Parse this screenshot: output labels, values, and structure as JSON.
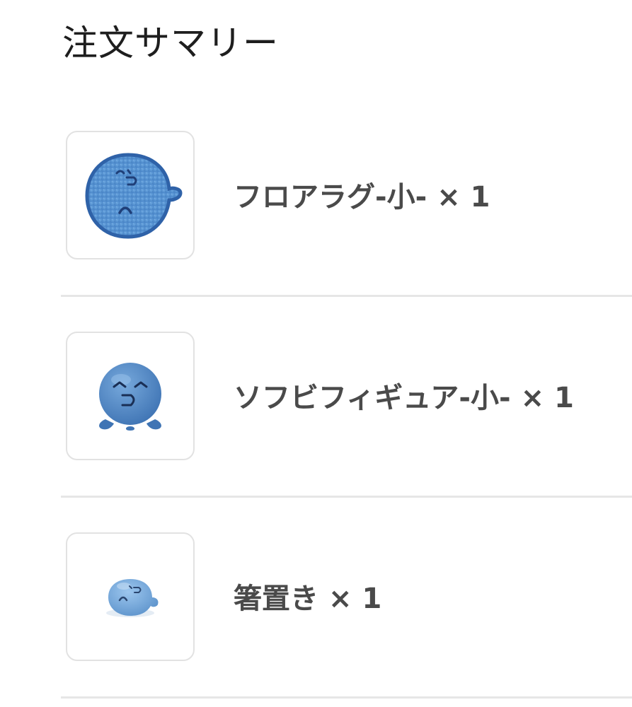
{
  "summary": {
    "title": "注文サマリー"
  },
  "items": [
    {
      "name": "フロアラグ-小-",
      "qty_prefix": "×",
      "qty": "1",
      "thumb_icon": "blue-floor-rug-image"
    },
    {
      "name": "ソフビフィギュア-小-",
      "qty_prefix": "×",
      "qty": "1",
      "thumb_icon": "blue-vinyl-figure-image"
    },
    {
      "name": "箸置き",
      "qty_prefix": "×",
      "qty": "1",
      "thumb_icon": "blue-chopstick-rest-image"
    }
  ],
  "colors": {
    "character_blue": "#4d86c4",
    "divider": "#e6e6e6",
    "label_text": "#4a4a4a",
    "thumb_border": "#e2e2e2"
  }
}
